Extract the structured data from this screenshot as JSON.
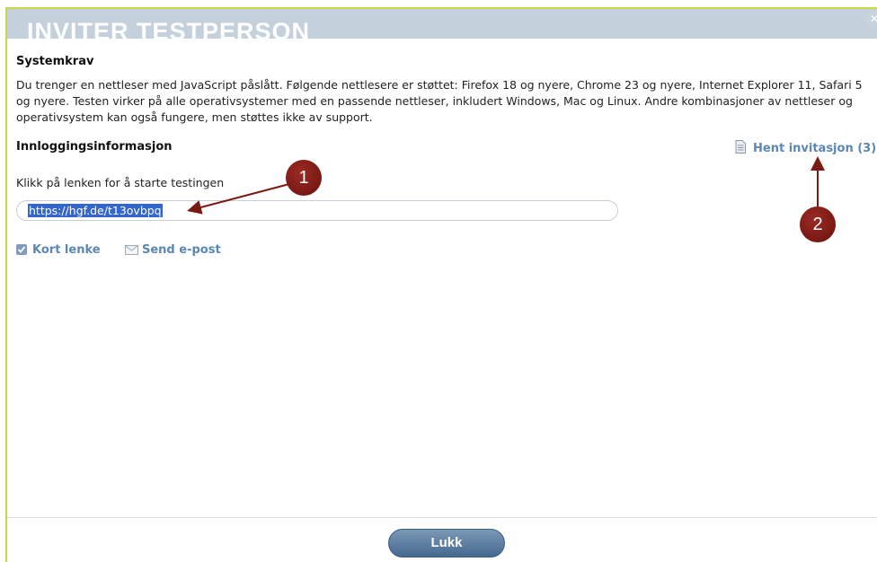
{
  "dialog": {
    "title": "INVITER TESTPERSON",
    "close_symbol": "✕"
  },
  "system": {
    "heading": "Systemkrav",
    "text": "Du trenger en nettleser med JavaScript påslått. Følgende nettlesere er støttet: Firefox 18 og nyere, Chrome 23 og nyere, Internet Explorer 11, Safari 5 og nyere. Testen virker på alle operativsystemer med en passende nettleser, inkludert Windows, Mac og Linux. Andre kombinasjoner av nettleser og operativsystem kan også fungere, men støttes ikke av support."
  },
  "login": {
    "heading": "Innloggingsinformasjon",
    "get_invitation": "Hent invitasjon (3)",
    "click_label": "Klikk på lenken for å starte testingen",
    "link": "https://hgf.de/t13ovbpq",
    "short_link_label": "Kort lenke",
    "short_link_checked": true,
    "send_email_label": "Send e-post"
  },
  "footer": {
    "close_label": "Lukk"
  },
  "annotations": {
    "marker1": "1",
    "marker2": "2"
  },
  "icons": [
    "close-icon",
    "document-icon",
    "checkbox-icon",
    "mail-icon"
  ],
  "colors": {
    "titlebar": "#c4d1dd",
    "link_blue": "#5a87b3",
    "selection": "#3366cc",
    "button": "#5a7fa5",
    "marker": "#7a1a14",
    "frame_accent": "#c9d84a"
  }
}
